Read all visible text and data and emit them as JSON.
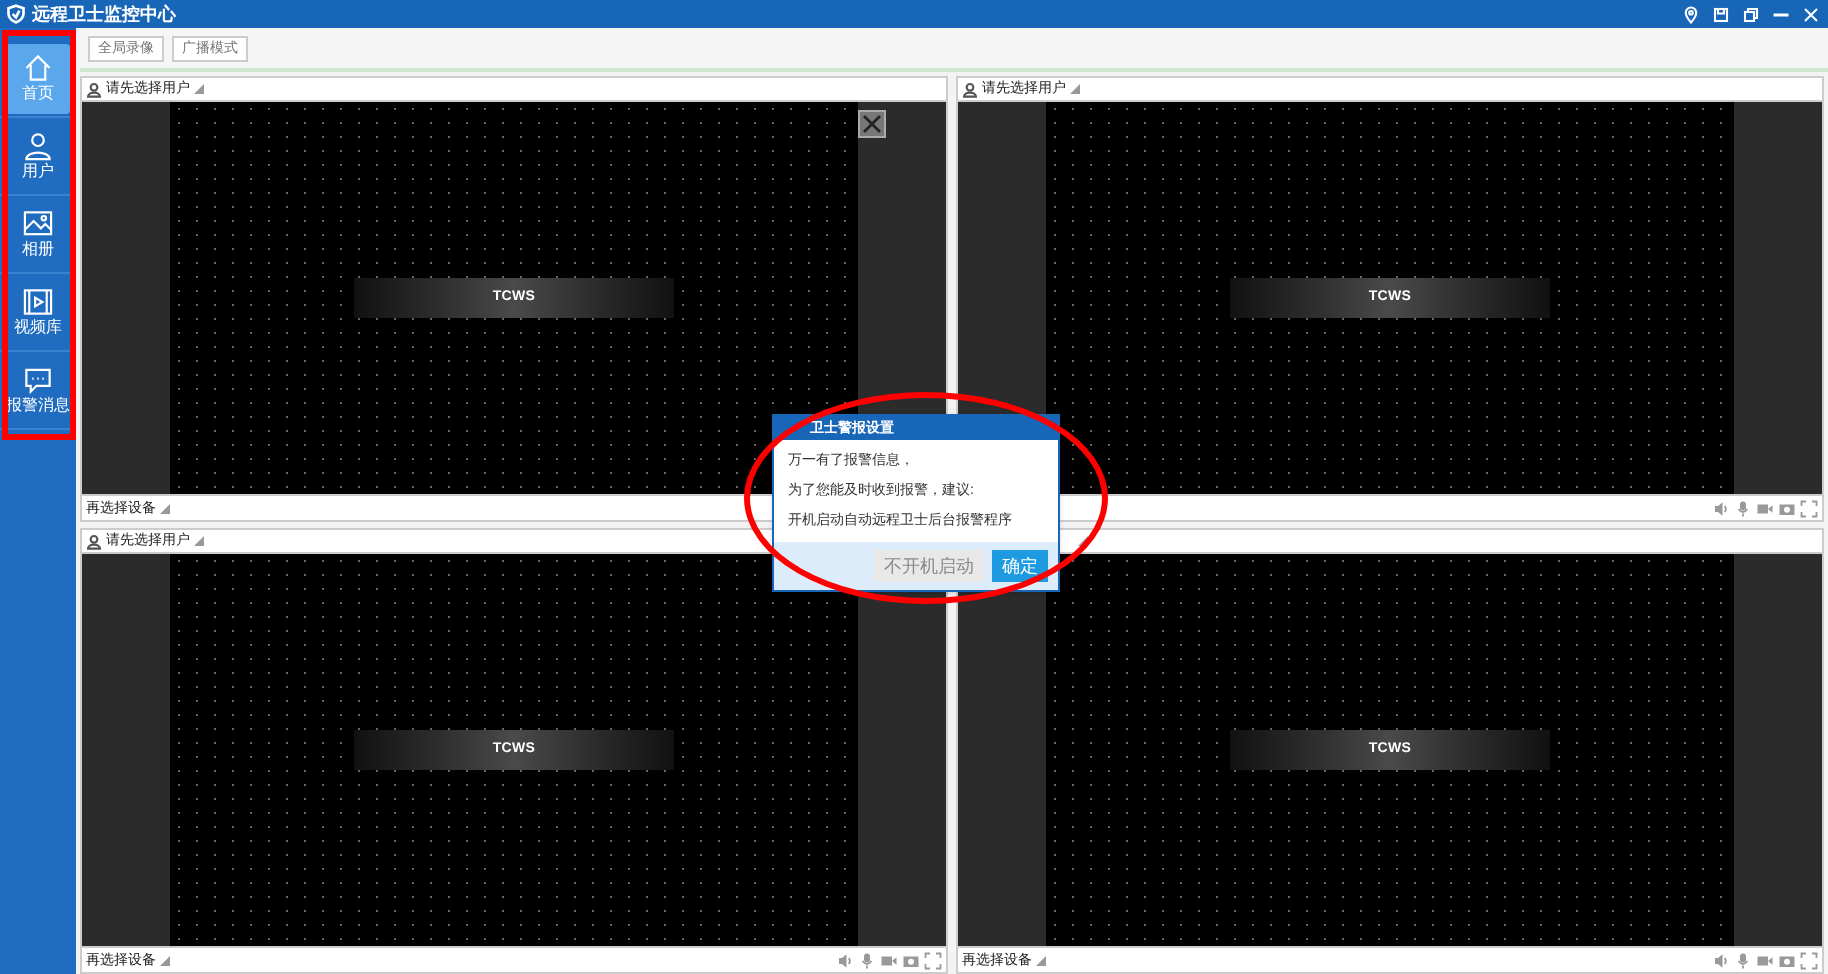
{
  "window": {
    "title": "远程卫士监控中心"
  },
  "toolbar": {
    "buttons": [
      "全局录像",
      "广播模式"
    ]
  },
  "sidebar": {
    "items": [
      {
        "label": "首页",
        "kind": "home",
        "selected": true
      },
      {
        "label": "用户",
        "kind": "user",
        "selected": false
      },
      {
        "label": "相册",
        "kind": "image",
        "selected": false
      },
      {
        "label": "视频库",
        "kind": "film",
        "selected": false
      },
      {
        "label": "报警消息",
        "kind": "chat",
        "selected": false
      }
    ]
  },
  "panels": [
    {
      "user_label": "请先选择用户",
      "device_label": "再选择设备",
      "video_text": "TCWS",
      "close_shown": true
    },
    {
      "user_label": "请先选择用户",
      "video_text": "TCWS",
      "close_shown": false
    },
    {
      "user_label": "请先选择用户",
      "device_label": "再选择设备",
      "video_text": "TCWS",
      "close_shown": false
    },
    {
      "device_label": "再选择设备",
      "video_text": "TCWS",
      "close_shown": false
    }
  ],
  "dialog": {
    "title": "卫士警报设置",
    "lines": [
      "万一有了报警信息，",
      "为了您能及时收到报警，建议:",
      "开机启动自动远程卫士后台报警程序"
    ],
    "buttons": [
      {
        "label": "不开机启动",
        "disabled": true
      },
      {
        "label": "确定",
        "disabled": false
      }
    ]
  },
  "annotations": [
    {
      "kind": "rect"
    },
    {
      "kind": "ellipse"
    }
  ]
}
